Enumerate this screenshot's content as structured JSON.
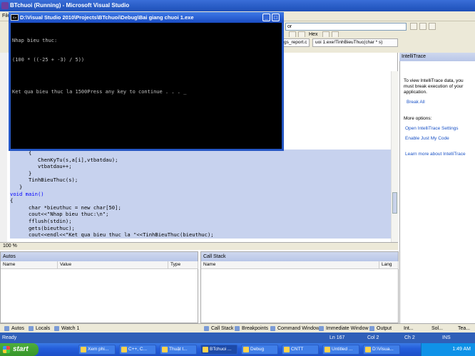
{
  "vs": {
    "title": "BTchuoi (Running) - Microsoft Visual Studio",
    "menu_first": "File",
    "combo_value": "or",
    "hex_label": "Hex",
    "doc_tabs": [
      "gs_report.c",
      "uoi 1.exe!TinhBieuThuc(char * s)"
    ],
    "zoom": "100 %"
  },
  "console": {
    "title": "D:\\Visual Studio 2010\\Projects\\BTchuoi\\Debug\\Bai giang chuoi 1.exe",
    "lines": [
      "Nhap bieu thuc:",
      "(100 * ((-25 + -3) / 5))",
      "",
      "Ket qua bieu thuc la 1500Press any key to continue . . . _"
    ]
  },
  "code": {
    "lines": [
      "      {",
      "         ChenKyTu(s,a[i],vtbatdau);",
      "         vtbatdau++;",
      "      }",
      "      TinhBieuThuc(s);",
      "   }",
      "void main()",
      "{",
      "      char *bieuthuc = new char[50];",
      "      cout<<\"Nhap bieu thuc:\\n\";",
      "      fflush(stdin);",
      "      gets(bieuthuc);",
      "      cout<<endl<<\"Ket qua bieu thuc la \"<<TinhBieuThuc(bieuthuc);"
    ]
  },
  "intellitrace": {
    "title": "IntelliTrace",
    "message": "To view IntelliTrace data, you must break execution of your application.",
    "break_all": "Break All",
    "more_options": "More options:",
    "settings": "Open IntelliTrace Settings",
    "just_my_code": "Enable Just My Code",
    "learn_more": "Learn more about IntelliTrace",
    "tabs": [
      "Int...",
      "Sol...",
      "Tea..."
    ]
  },
  "autos": {
    "title": "Autos",
    "columns": [
      "Name",
      "Value",
      "Type"
    ]
  },
  "callstack": {
    "title": "Call Stack",
    "columns": [
      "Name",
      "Lang"
    ]
  },
  "bottom_tabs": [
    "Autos",
    "Locals",
    "Watch 1",
    "Call Stack",
    "Breakpoints",
    "Command Window",
    "Immediate Window",
    "Output"
  ],
  "status": {
    "ready": "Ready",
    "ln": "Ln 167",
    "col": "Col 2",
    "ch": "Ch 2",
    "ins": "INS"
  },
  "taskbar": {
    "start": "start",
    "tasks": [
      "Xem phi...",
      "C++, C...",
      "Thuật t...",
      "BTchuoi ...",
      "Debug",
      "CNTT",
      "Untitled ...",
      "D:\\Visua..."
    ],
    "time": "1:49 AM"
  },
  "colors": {
    "title_blue": "#245edb",
    "selection": "#c7d2ee",
    "keyword": "#0000ff",
    "status_bar": "#2f5fb8"
  }
}
